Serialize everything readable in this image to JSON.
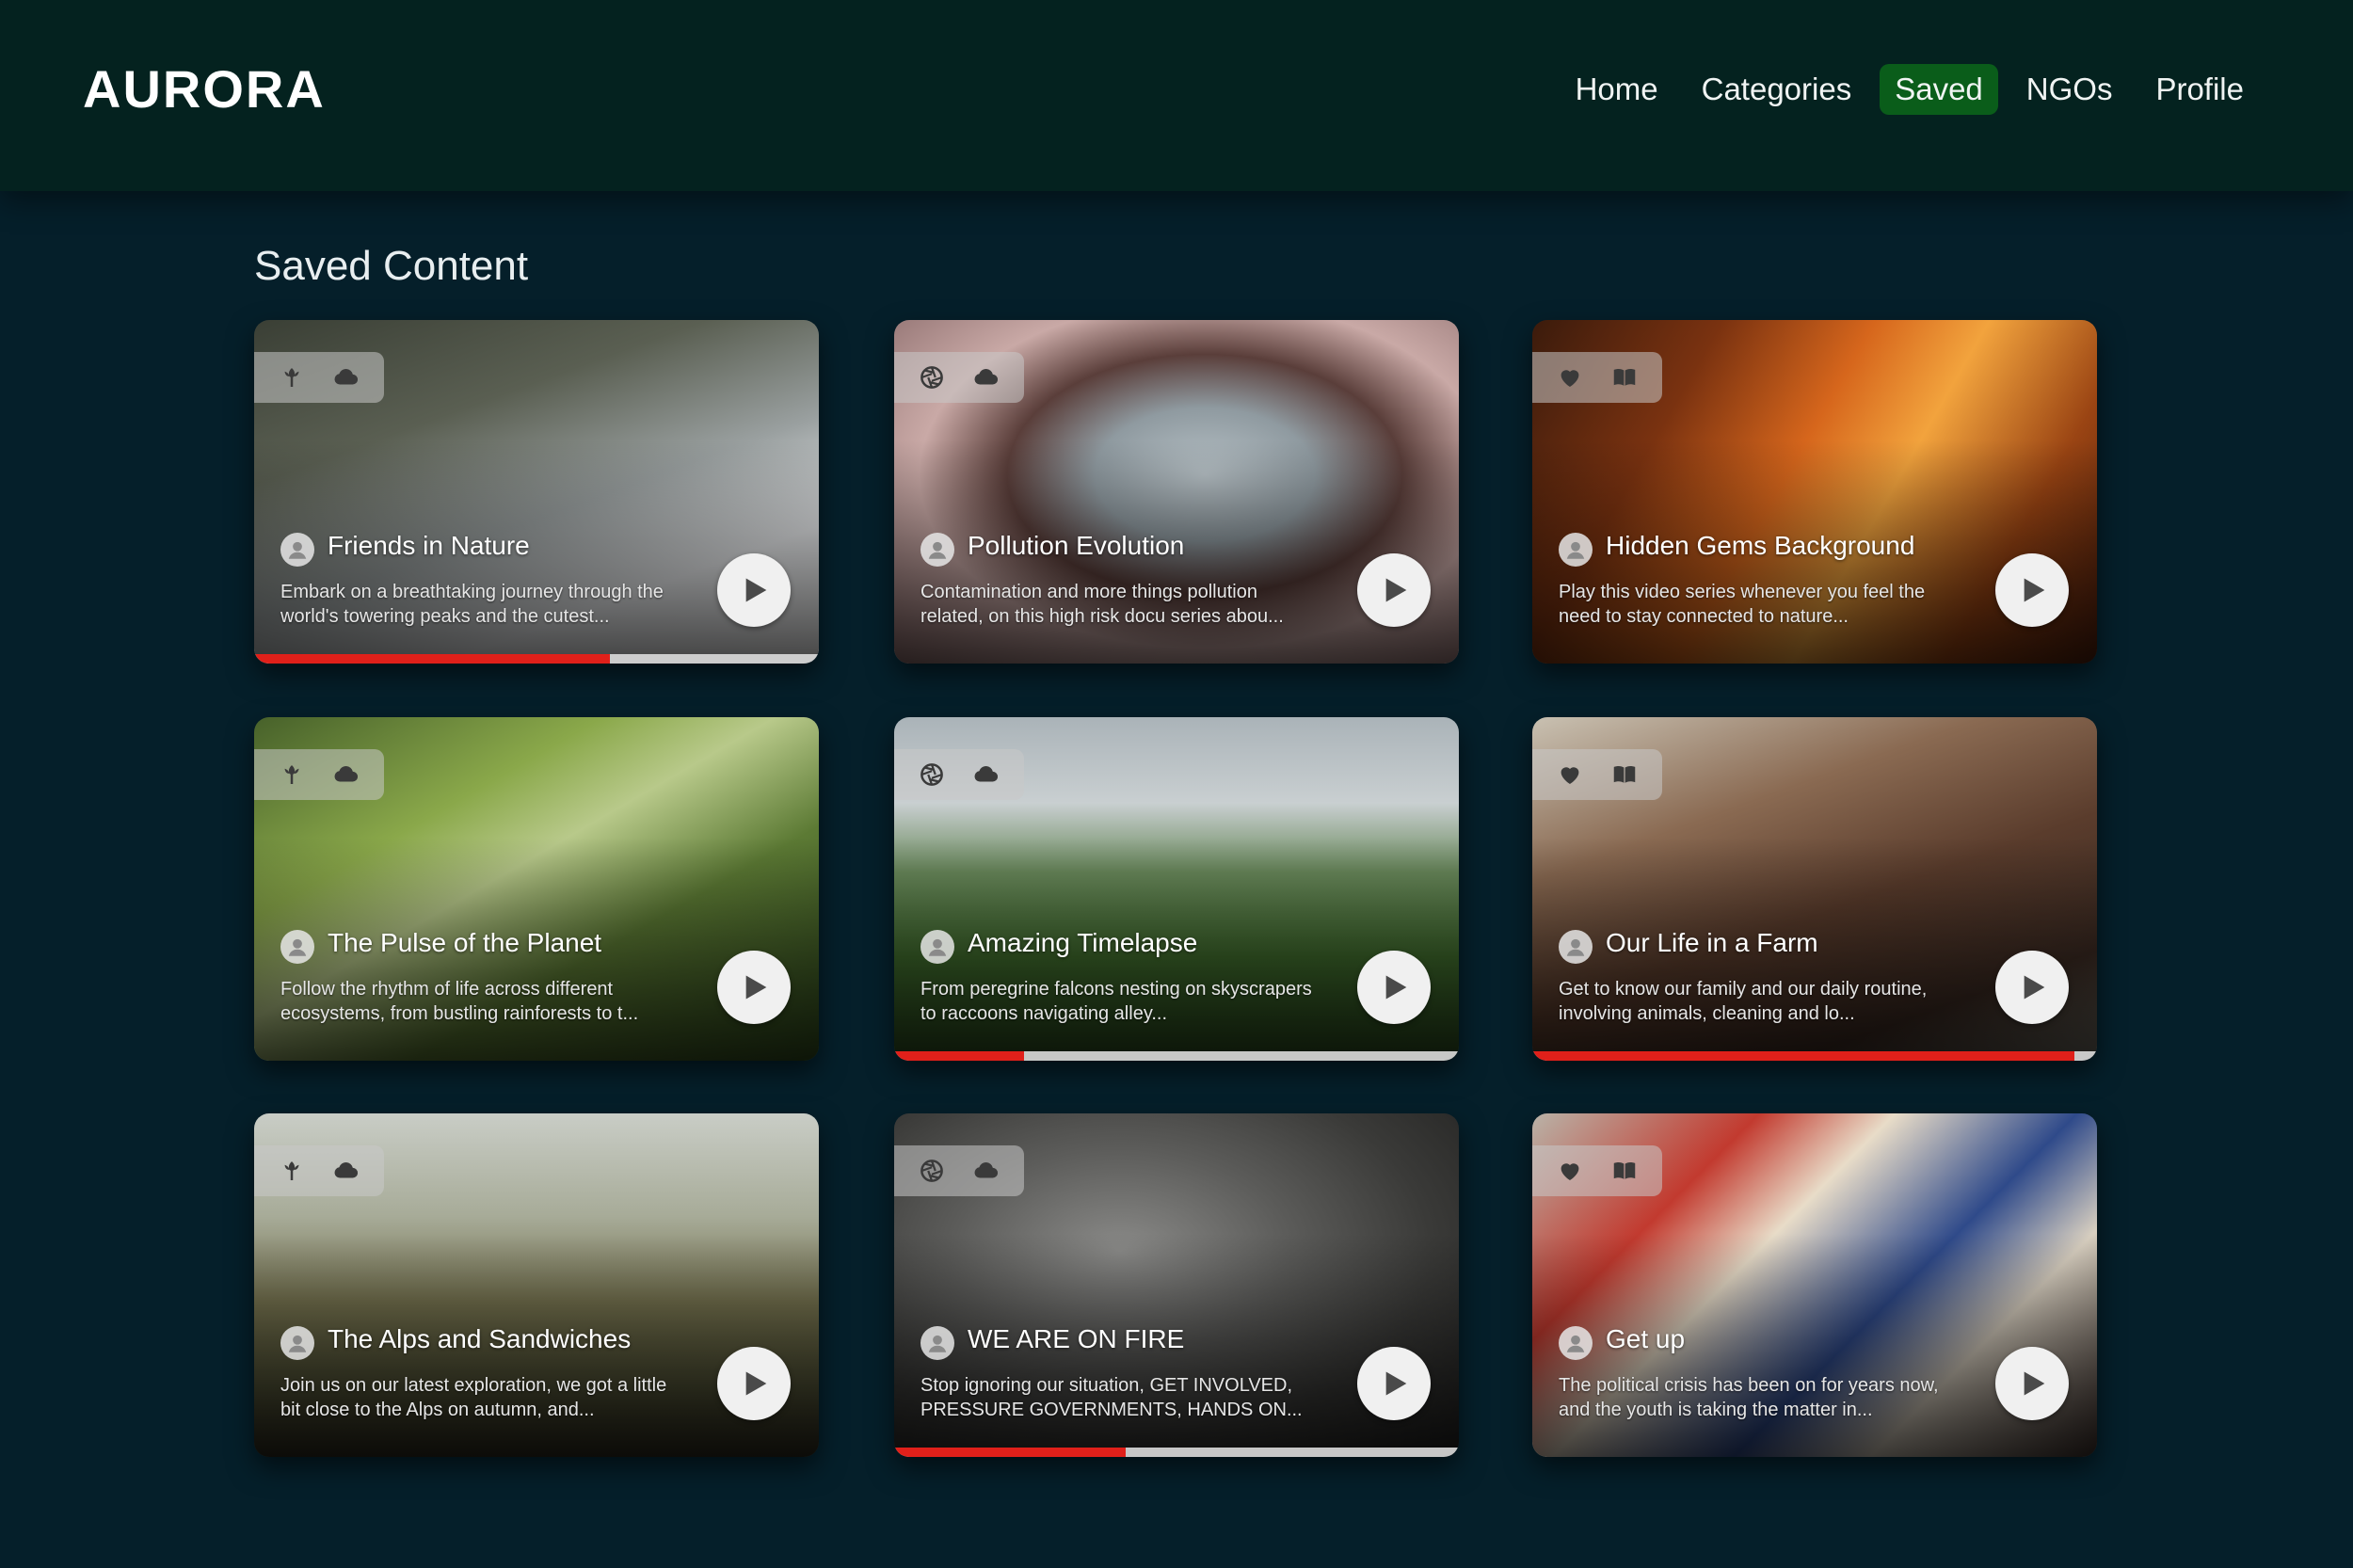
{
  "header": {
    "logo": "AURORA",
    "nav": [
      {
        "label": "Home",
        "active": false
      },
      {
        "label": "Categories",
        "active": false
      },
      {
        "label": "Saved",
        "active": true
      },
      {
        "label": "NGOs",
        "active": false
      },
      {
        "label": "Profile",
        "active": false
      }
    ]
  },
  "main": {
    "title": "Saved Content",
    "cards": [
      {
        "title": "Friends in Nature",
        "description": "Embark on a breathtaking journey through the world's towering peaks and the cutest...",
        "badges": [
          "tulip-icon",
          "cloud-icon"
        ],
        "progress": 0.63,
        "theme": "snow"
      },
      {
        "title": "Pollution Evolution",
        "description": "Contamination and more things pollution related, on this high risk docu series abou...",
        "badges": [
          "aperture-icon",
          "cloud-icon"
        ],
        "progress": null,
        "theme": "river"
      },
      {
        "title": "Hidden Gems Background",
        "description": "Play this video series whenever you feel the need to stay connected to nature...",
        "badges": [
          "heart-icon",
          "book-icon"
        ],
        "progress": null,
        "theme": "autumn"
      },
      {
        "title": "The Pulse of the Planet",
        "description": "Follow the rhythm of life across different ecosystems, from bustling rainforests to t...",
        "badges": [
          "tulip-icon",
          "cloud-icon"
        ],
        "progress": null,
        "theme": "forest"
      },
      {
        "title": "Amazing Timelapse",
        "description": "From peregrine falcons nesting on skyscrapers to raccoons navigating alley...",
        "badges": [
          "aperture-icon",
          "cloud-icon"
        ],
        "progress": 0.23,
        "theme": "mountain"
      },
      {
        "title": "Our Life in a Farm",
        "description": "Get to know our family and our daily routine, involving animals, cleaning and lo...",
        "badges": [
          "heart-icon",
          "book-icon"
        ],
        "progress": 0.96,
        "theme": "farm"
      },
      {
        "title": "The Alps and Sandwiches",
        "description": "Join us on our latest exploration, we got a little bit close to the Alps on autumn, and...",
        "badges": [
          "tulip-icon",
          "cloud-icon"
        ],
        "progress": null,
        "theme": "alps"
      },
      {
        "title": "WE ARE ON FIRE",
        "description": "Stop ignoring our situation, GET INVOLVED, PRESSURE GOVERNMENTS, HANDS ON...",
        "badges": [
          "aperture-icon",
          "cloud-icon"
        ],
        "progress": 0.41,
        "theme": "fire"
      },
      {
        "title": "Get up",
        "description": "The political crisis has been on for years now, and the youth is taking the matter in...",
        "badges": [
          "heart-icon",
          "book-icon"
        ],
        "progress": null,
        "theme": "protest"
      }
    ]
  },
  "colors": {
    "background": "#051f2a",
    "header": "#04221f",
    "active_nav": "#0a5d1a",
    "progress": "#e0201a"
  }
}
